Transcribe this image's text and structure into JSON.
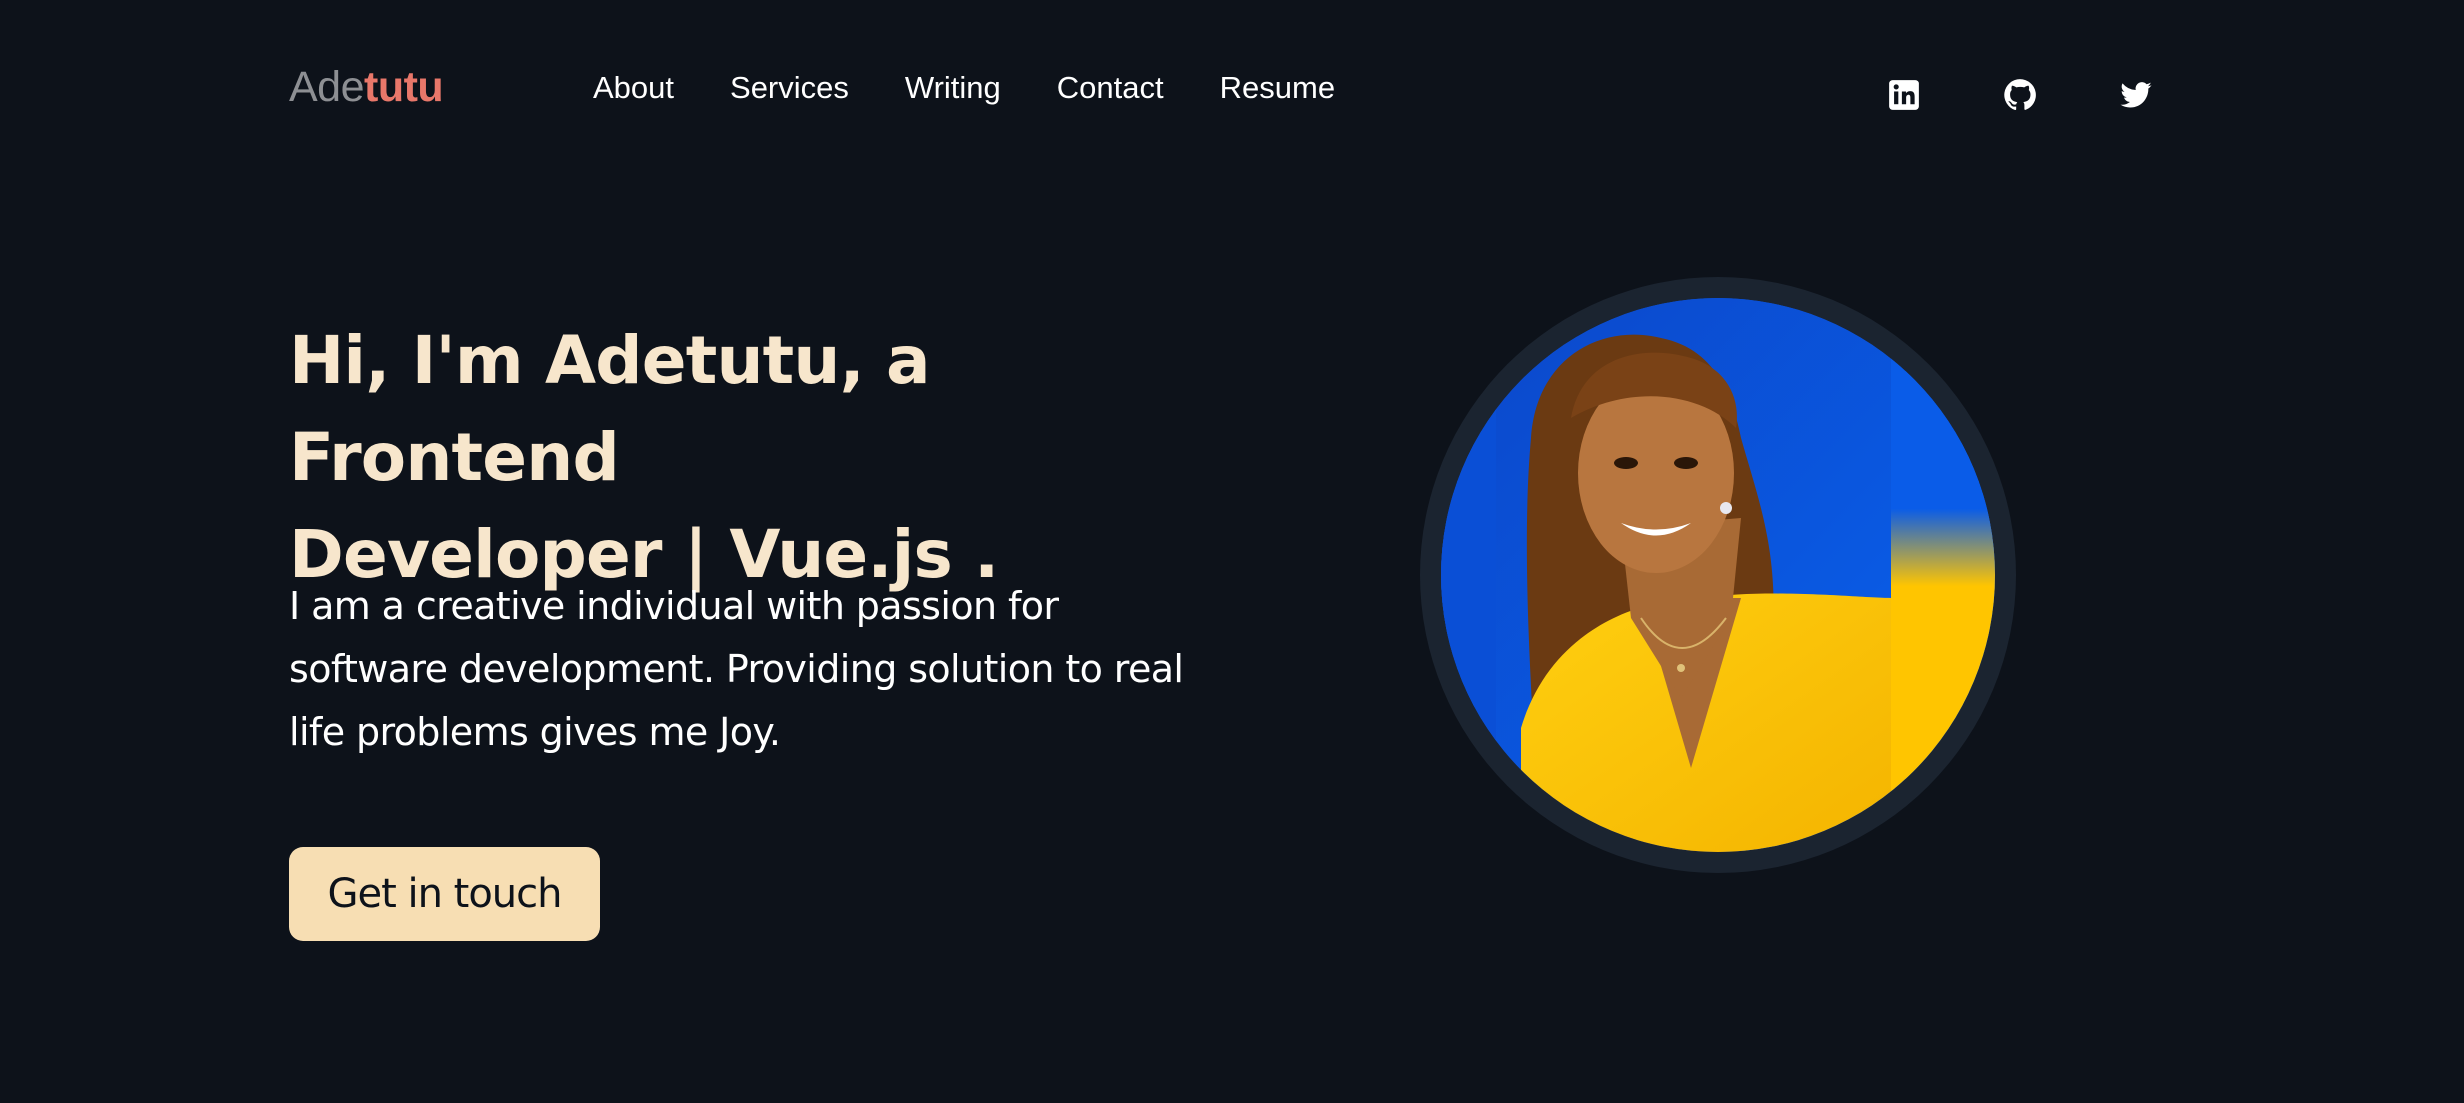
{
  "logo": {
    "first": "Ade",
    "second": "tutu"
  },
  "nav": {
    "items": [
      {
        "label": "About"
      },
      {
        "label": "Services"
      },
      {
        "label": "Writing"
      },
      {
        "label": "Contact"
      },
      {
        "label": "Resume"
      }
    ]
  },
  "social": {
    "icons": [
      "linkedin-icon",
      "github-icon",
      "twitter-icon"
    ]
  },
  "hero": {
    "title_line1": "Hi, I'm Adetutu, a Frontend",
    "title_line2": "Developer | Vue.js .",
    "description": "I am a creative individual with passion for software development. Providing solution to real life problems gives me Joy.",
    "cta_label": "Get in touch"
  },
  "colors": {
    "background": "#0d121a",
    "accent": "#e8776a",
    "heading": "#f7e6cc",
    "button": "#f7deb3",
    "portrait_blue": "#0a57e0",
    "portrait_yellow": "#ffc500"
  }
}
